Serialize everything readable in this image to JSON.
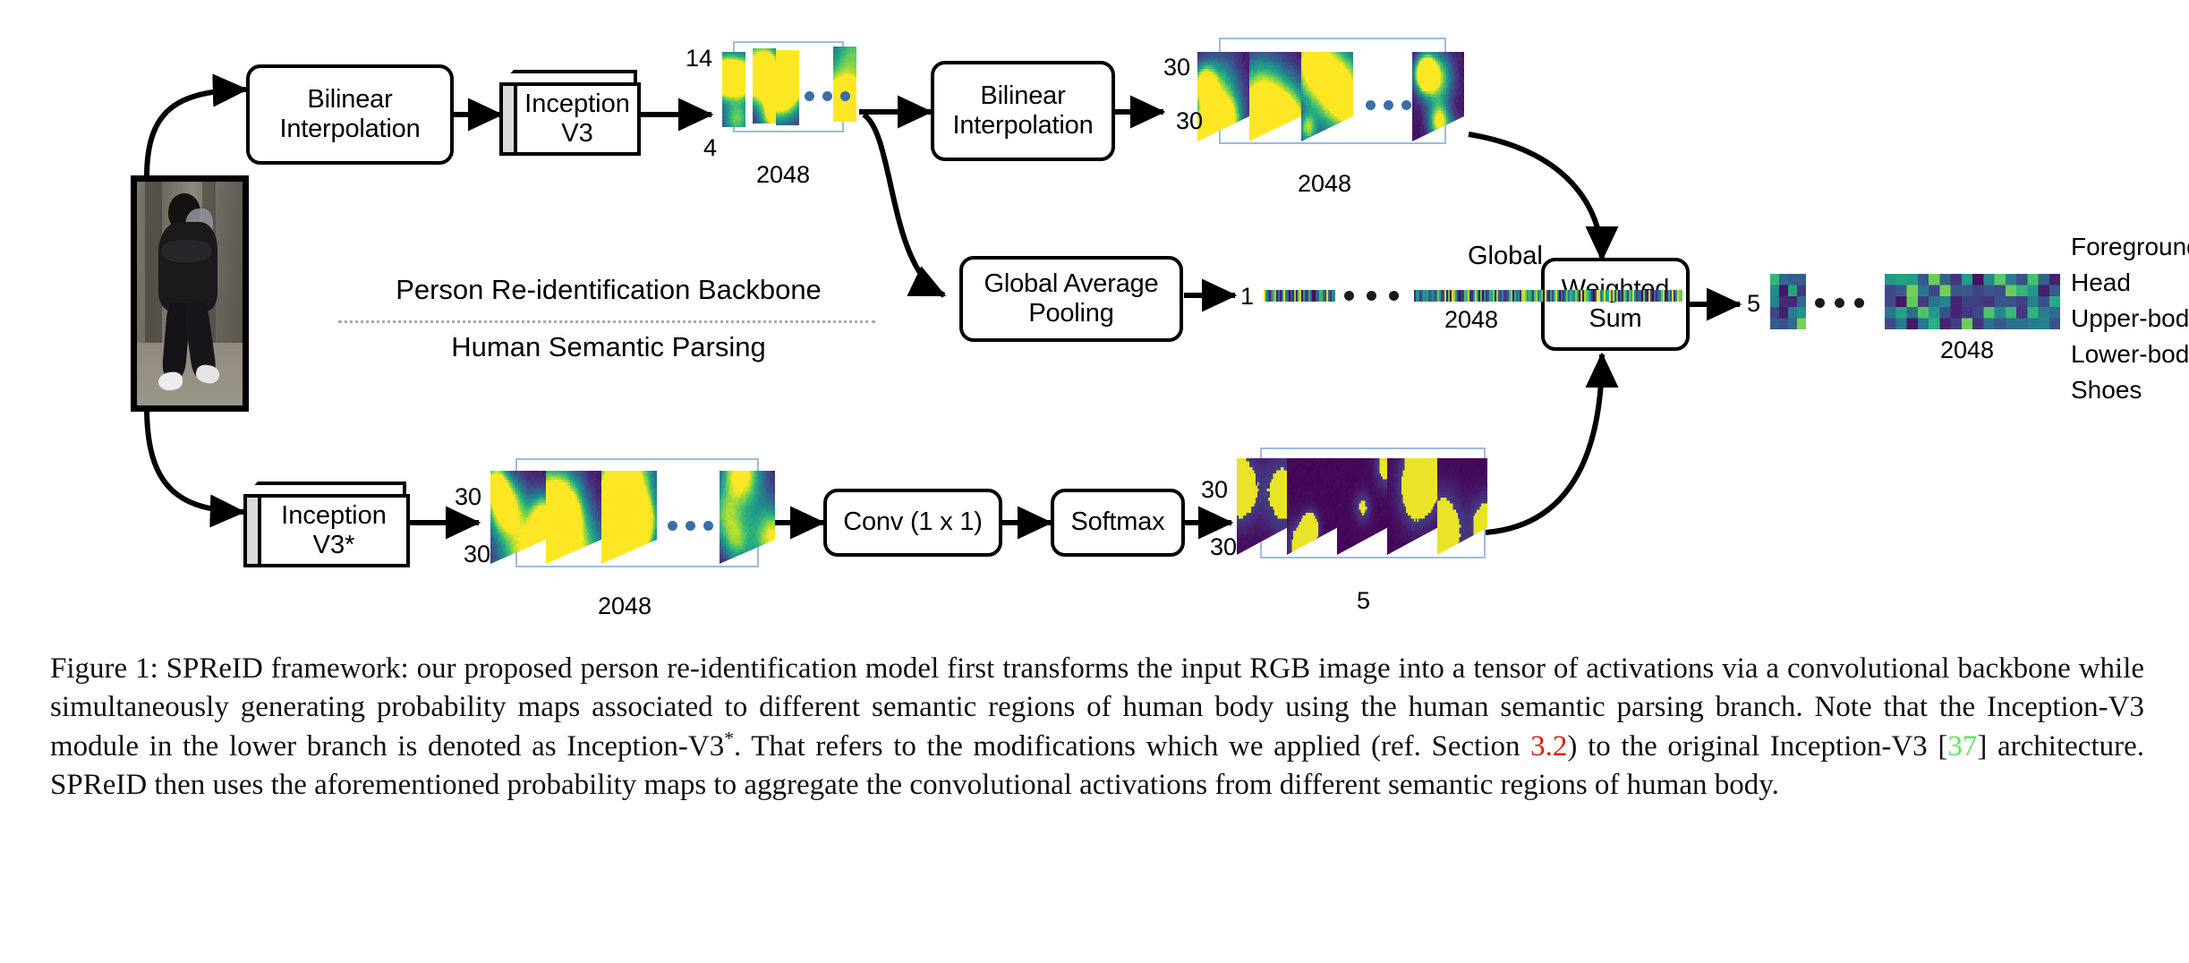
{
  "figure": {
    "input": {
      "name": "person-image",
      "alt": "Input RGB pedestrian image"
    },
    "boxes": {
      "bilinear_top": {
        "line1": "Bilinear",
        "line2": "Interpolation"
      },
      "inception_v3": {
        "line1": "Inception",
        "line2": "V3"
      },
      "bilinear_mid": {
        "line1": "Bilinear",
        "line2": "Interpolation"
      },
      "gap": {
        "line1": "Global Average",
        "line2": "Pooling"
      },
      "weighted_sum": {
        "line1": "Weighted",
        "line2": "Sum"
      },
      "inception_v3s": {
        "line1": "Inception",
        "line2": "V3*"
      },
      "conv": {
        "line1": "Conv (1 x 1)",
        "line2": ""
      },
      "softmax": {
        "line1": "Softmax",
        "line2": ""
      }
    },
    "branch_labels": {
      "top": "Person Re-identification Backbone",
      "bottom": "Human Semantic Parsing"
    },
    "tensor_a": {
      "height": "14",
      "width": "4",
      "depth": "2048"
    },
    "tensor_b": {
      "height": "30",
      "width": "30",
      "depth": "2048"
    },
    "tensor_c": {
      "height": "30",
      "width": "30",
      "depth": "2048"
    },
    "tensor_d": {
      "height": "30",
      "width": "30",
      "depth": "5"
    },
    "gap_vector": {
      "rows": "1",
      "depth": "2048",
      "title": "Global"
    },
    "output_map": {
      "rows": "5",
      "depth": "2048"
    },
    "output_legend": [
      "Foreground",
      "Head",
      "Upper-body",
      "Lower-body",
      "Shoes"
    ],
    "ellipsis": "• • •"
  },
  "caption": {
    "label": "Figure 1:",
    "part1": " SPReID framework: our proposed person re-identification model first transforms the input RGB image into a tensor of activations via a convolutional backbone while simultaneously generating probability maps associated to different semantic regions of human body using the human semantic parsing branch.  Note that the Inception-V3 module in the lower branch is denoted as Inception-V3",
    "star": "*",
    "part2": ".  That refers to the modifications which we applied (ref.  Section ",
    "ref_section": "3.2",
    "part3": ") to the original Inception-V3 [",
    "ref_citation": "37",
    "part4": "] architecture.  SPReID then uses the aforementioned probability maps to aggregate the convolutional activations from different semantic regions of human body."
  },
  "colors": {
    "accent_red": "#d81f06",
    "accent_green": "#5ce65c",
    "wire": "#000000",
    "tensor_frame": "#9dbbdd",
    "viridis_dark": "#3b0f54",
    "viridis_mid": "#2a788e",
    "viridis_bright": "#f7e225"
  }
}
